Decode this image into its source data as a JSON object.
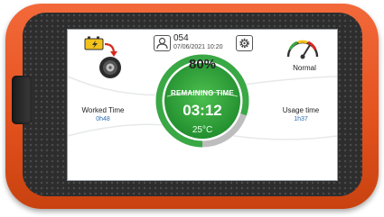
{
  "header": {
    "user_icon": "user-icon",
    "user_number": "054",
    "datetime": "07/06/2021 10:20",
    "settings_icon": "gear-icon"
  },
  "battery": {
    "icon": "battery-charging-tire-icon"
  },
  "gauge": {
    "icon": "speed-gauge-icon",
    "status": "Normal"
  },
  "ring": {
    "percent": "80%",
    "progress": 0.8,
    "remaining_label": "REMAINING TIME",
    "time": "03:12",
    "temperature": "25°C"
  },
  "worked": {
    "label": "Worked Time",
    "value": "0h48"
  },
  "usage": {
    "label": "Usage time",
    "value": "1h37"
  },
  "colors": {
    "housing": "#e4521f",
    "ring_green": "#39a845",
    "ring_track": "#bdbdbd",
    "value_blue": "#2b6cb0"
  }
}
